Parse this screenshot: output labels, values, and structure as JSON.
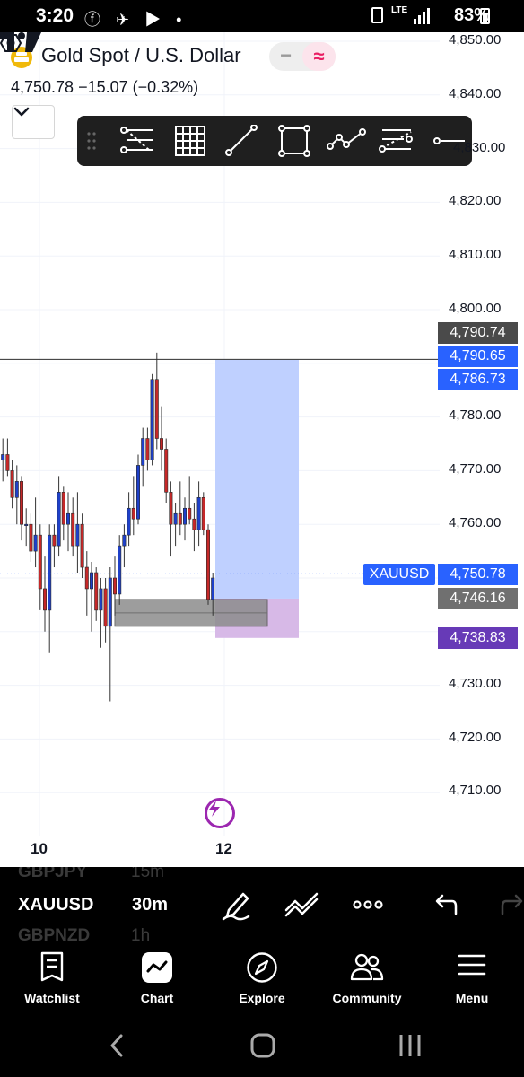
{
  "status_bar": {
    "time": "3:20",
    "status_icons": "ⓕ ✈ ▶ •",
    "network": "LTE",
    "battery": "83%"
  },
  "header": {
    "symbol_title": "Gold Spot / U.S. Dollar",
    "price_change": "4,750.78  −15.07 (−0.32%)",
    "minus_label": "−",
    "approx_label": "≈"
  },
  "drawing_toolbar": {
    "tools": [
      "fib-retracement",
      "gann-box",
      "trend-line",
      "rectangle",
      "path",
      "pitchfork",
      "horizontal-ray"
    ]
  },
  "price_axis": {
    "ticks": [
      "4,850.00",
      "4,840.00",
      "4,830.00",
      "4,820.00",
      "4,810.00",
      "4,800.00",
      "4,780.00",
      "4,770.00",
      "4,760.00",
      "4,730.00",
      "4,720.00",
      "4,710.00"
    ]
  },
  "price_labels": {
    "line_level": "4,790.74",
    "target_top": "4,790.65",
    "target_mid": "4,786.73",
    "current": "4,750.78",
    "entry": "4,746.16",
    "stop": "4,738.83",
    "symbol_tag": "XAUUSD"
  },
  "chart_data": {
    "type": "candlestick",
    "symbol": "XAUUSD",
    "timeframe": "30m",
    "x_ticks": [
      "10",
      "12"
    ],
    "ylim": [
      4706,
      4852
    ],
    "horizontal_line": 4790.74,
    "long_position": {
      "target": 4790.65,
      "entry": 4746.16,
      "stop": 4738.83
    },
    "demand_zone": [
      4741,
      4746
    ],
    "colors": {
      "up": "#1e40c9",
      "down": "#c62828",
      "target_zone": "#bcceff",
      "stop_zone": "#d5b5e6",
      "accent": "#2962ff",
      "stop_label": "#673ab7",
      "entry_label": "#707070",
      "line_label": "#4a4a4a"
    },
    "candles": [
      [
        4781,
        4782,
        4771,
        4772
      ],
      [
        4772,
        4776,
        4768,
        4773
      ],
      [
        4773,
        4776,
        4769,
        4770
      ],
      [
        4770,
        4772,
        4763,
        4765
      ],
      [
        4765,
        4771,
        4760,
        4768
      ],
      [
        4768,
        4769,
        4757,
        4760
      ],
      [
        4760,
        4763,
        4756,
        4760
      ],
      [
        4760,
        4762,
        4753,
        4755
      ],
      [
        4755,
        4765,
        4752,
        4758
      ],
      [
        4758,
        4760,
        4744,
        4748
      ],
      [
        4748,
        4754,
        4740,
        4744
      ],
      [
        4744,
        4760,
        4736,
        4758
      ],
      [
        4758,
        4760,
        4752,
        4756
      ],
      [
        4756,
        4769,
        4754,
        4766
      ],
      [
        4766,
        4767,
        4757,
        4760
      ],
      [
        4760,
        4766,
        4755,
        4762
      ],
      [
        4762,
        4765,
        4754,
        4756
      ],
      [
        4756,
        4766,
        4751,
        4760
      ],
      [
        4760,
        4762,
        4750,
        4752
      ],
      [
        4752,
        4755,
        4743,
        4748
      ],
      [
        4748,
        4753,
        4740,
        4751
      ],
      [
        4751,
        4752,
        4742,
        4744
      ],
      [
        4744,
        4750,
        4737,
        4748
      ],
      [
        4748,
        4750,
        4738,
        4741
      ],
      [
        4741,
        4752,
        4727,
        4750
      ],
      [
        4750,
        4754,
        4743,
        4747
      ],
      [
        4747,
        4758,
        4745,
        4756
      ],
      [
        4756,
        4760,
        4752,
        4758
      ],
      [
        4758,
        4766,
        4756,
        4763
      ],
      [
        4763,
        4769,
        4758,
        4761
      ],
      [
        4761,
        4773,
        4760,
        4771
      ],
      [
        4771,
        4778,
        4767,
        4776
      ],
      [
        4776,
        4778,
        4770,
        4772
      ],
      [
        4772,
        4788,
        4771,
        4787
      ],
      [
        4787,
        4792,
        4774,
        4776
      ],
      [
        4776,
        4782,
        4770,
        4774
      ],
      [
        4774,
        4776,
        4764,
        4766
      ],
      [
        4766,
        4768,
        4754,
        4760
      ],
      [
        4760,
        4764,
        4756,
        4762
      ],
      [
        4762,
        4768,
        4758,
        4760
      ],
      [
        4760,
        4765,
        4757,
        4763
      ],
      [
        4763,
        4769,
        4760,
        4761
      ],
      [
        4761,
        4764,
        4755,
        4759
      ],
      [
        4759,
        4768,
        4756,
        4765
      ],
      [
        4765,
        4766,
        4758,
        4759
      ],
      [
        4759,
        4760,
        4745,
        4746
      ],
      [
        4746,
        4751,
        4743,
        4750
      ]
    ]
  },
  "bottom_toolbar": {
    "ghost_prev_symbol": "GBPJPY",
    "ghost_prev_tf": "15m",
    "symbol": "XAUUSD",
    "timeframe": "30m",
    "ghost_next_symbol": "GBPNZD",
    "ghost_next_tf": "1h"
  },
  "bottom_nav": {
    "items": [
      {
        "label": "Watchlist",
        "icon": "watchlist-icon"
      },
      {
        "label": "Chart",
        "icon": "chart-icon"
      },
      {
        "label": "Explore",
        "icon": "compass-icon"
      },
      {
        "label": "Community",
        "icon": "community-icon"
      },
      {
        "label": "Menu",
        "icon": "menu-icon"
      }
    ]
  }
}
